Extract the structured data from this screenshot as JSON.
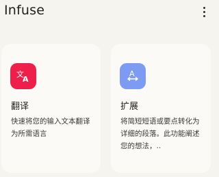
{
  "header": {
    "title": "Infuse",
    "menu_icon": "more-vert-icon"
  },
  "cards": [
    {
      "title": "翻译",
      "description": "快速将您的输入文本翻译为所需语言",
      "icon": "translate-icon",
      "icon_color": "#ef1f4b"
    },
    {
      "title": "扩展",
      "description": "将简短短语或要点转化为详细的段落。此功能阐述您的想法，..",
      "icon": "expand-icon",
      "icon_color": "#7d9bf2"
    }
  ]
}
